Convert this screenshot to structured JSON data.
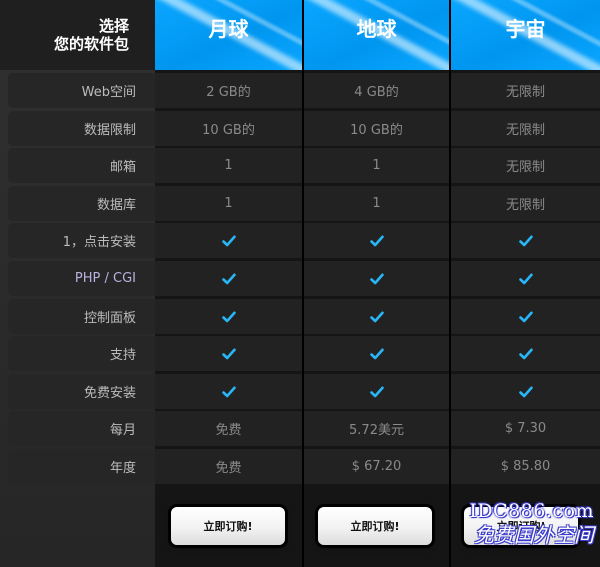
{
  "header": {
    "title_line1": "选择",
    "title_line2": "您的软件包"
  },
  "plans": [
    {
      "name": "月球"
    },
    {
      "name": "地球"
    },
    {
      "name": "宇宙"
    }
  ],
  "rows": [
    {
      "label": "Web空间",
      "values": [
        "2 GB的",
        "4 GB的",
        "无限制"
      ]
    },
    {
      "label": "数据限制",
      "values": [
        "10 GB的",
        "10 GB的",
        "无限制"
      ]
    },
    {
      "label": "邮箱",
      "values": [
        "1",
        "1",
        "无限制"
      ]
    },
    {
      "label": "数据库",
      "values": [
        "1",
        "1",
        "无限制"
      ]
    },
    {
      "label": "1，点击安装",
      "values": [
        "check",
        "check",
        "check"
      ]
    },
    {
      "label": "PHP / CGI",
      "values": [
        "check",
        "check",
        "check"
      ]
    },
    {
      "label": "控制面板",
      "values": [
        "check",
        "check",
        "check"
      ]
    },
    {
      "label": "支持",
      "values": [
        "check",
        "check",
        "check"
      ]
    },
    {
      "label": "免费安装",
      "values": [
        "check",
        "check",
        "check"
      ]
    },
    {
      "label": "每月",
      "values": [
        "免费",
        "5.72美元",
        "$ 7.30"
      ]
    },
    {
      "label": "年度",
      "values": [
        "免费",
        "$ 67.20",
        "$ 85.80"
      ]
    }
  ],
  "order_button_label": "立即订购!",
  "watermark": {
    "line1": "IDC886.com",
    "line2": "免费国外空间"
  },
  "colors": {
    "header_blue": "#0aa6ff",
    "check_blue": "#29b6f6"
  }
}
